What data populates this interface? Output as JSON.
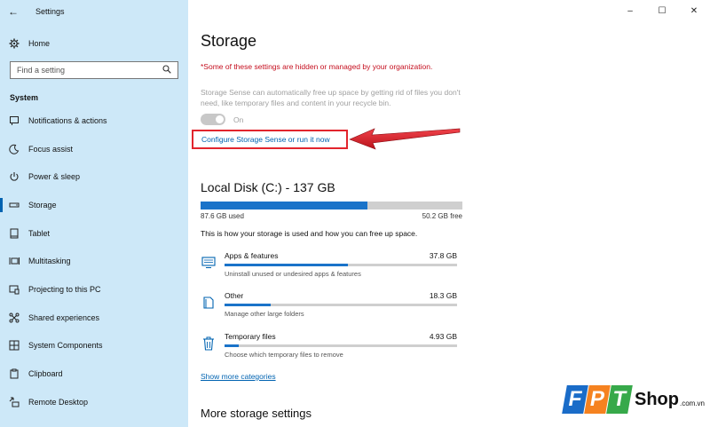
{
  "window": {
    "title": "Settings",
    "back_icon": "back-arrow-icon",
    "minimize": "–",
    "maximize": "☐",
    "close": "✕"
  },
  "sidebar": {
    "home_label": "Home",
    "search_placeholder": "Find a setting",
    "section": "System",
    "items": [
      {
        "label": "Notifications & actions",
        "icon": "notifications-icon"
      },
      {
        "label": "Focus assist",
        "icon": "focus-moon-icon"
      },
      {
        "label": "Power & sleep",
        "icon": "power-icon"
      },
      {
        "label": "Storage",
        "icon": "storage-drive-icon",
        "active": true
      },
      {
        "label": "Tablet",
        "icon": "tablet-icon"
      },
      {
        "label": "Multitasking",
        "icon": "multitasking-icon"
      },
      {
        "label": "Projecting to this PC",
        "icon": "projecting-icon"
      },
      {
        "label": "Shared experiences",
        "icon": "shared-experiences-icon"
      },
      {
        "label": "System Components",
        "icon": "components-icon"
      },
      {
        "label": "Clipboard",
        "icon": "clipboard-icon"
      },
      {
        "label": "Remote Desktop",
        "icon": "remote-desktop-icon"
      }
    ]
  },
  "main": {
    "title": "Storage",
    "org_warning": "*Some of these settings are hidden or managed by your organization.",
    "storage_sense_desc": "Storage Sense can automatically free up space by getting rid of files you don't need, like temporary files and content in your recycle bin.",
    "toggle_label": "On",
    "configure_link": "Configure Storage Sense or run it now",
    "disk": {
      "title": "Local Disk (C:) - 137 GB",
      "used": "87.6 GB used",
      "free": "50.2 GB free",
      "used_fraction": 0.636
    },
    "disk_info": "This is how your storage is used and how you can free up space.",
    "categories": [
      {
        "name": "Apps & features",
        "size": "37.8 GB",
        "sub": "Uninstall unused or undesired apps & features",
        "fraction": 0.53,
        "icon": "apps-monitor-icon"
      },
      {
        "name": "Other",
        "size": "18.3 GB",
        "sub": "Manage other large folders",
        "fraction": 0.2,
        "icon": "other-files-icon"
      },
      {
        "name": "Temporary files",
        "size": "4.93 GB",
        "sub": "Choose which temporary files to remove",
        "fraction": 0.06,
        "icon": "trash-icon"
      }
    ],
    "show_more": "Show more categories",
    "more_settings": "More storage settings"
  },
  "watermark": {
    "letters": [
      "F",
      "P",
      "T"
    ],
    "shop": "Shop",
    "domain": ".com.vn",
    "colors": [
      "#1a6cc8",
      "#f58220",
      "#37a94a"
    ]
  },
  "colors": {
    "sidebar_bg": "#cde8f8",
    "accent": "#0063b1",
    "warning": "#c50f1f",
    "highlight_box": "#e2252d"
  }
}
